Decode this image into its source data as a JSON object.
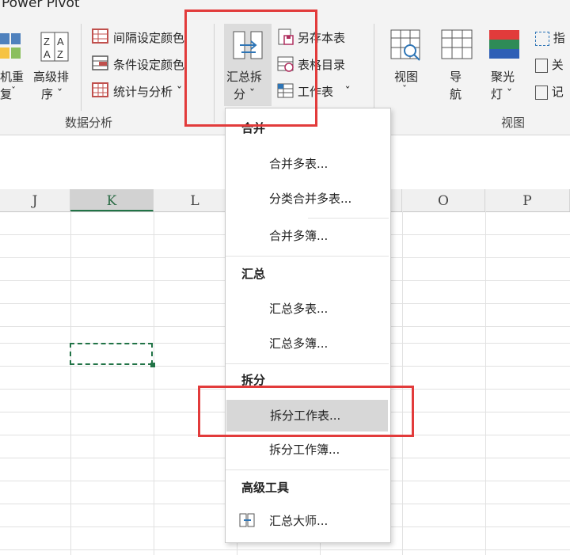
{
  "app_title": "Power Pivot",
  "ribbon": {
    "left_partial_btn": {
      "label_line1": "机重",
      "label_line2": "复"
    },
    "sort_btn": {
      "label_line1": "高级排",
      "label_line2": "序"
    },
    "interval_color": "间隔设定颜色",
    "condition_color": "条件设定颜色",
    "stats_analysis": "统计与分析",
    "group_data_analysis": "数据分析",
    "summary_split": {
      "label_line1": "汇总拆",
      "label_line2": "分"
    },
    "save_as_sheet": "另存本表",
    "sheet_catalog": "表格目录",
    "worksheet": "工作表",
    "view_btn": "视图",
    "nav_btn": {
      "line1": "导",
      "line2": "航"
    },
    "spotlight_btn": {
      "line1": "聚光",
      "line2": "灯"
    },
    "group_view": "视图",
    "right_partial_1": "指",
    "right_partial_2": "关",
    "right_partial_3": "记"
  },
  "columns": [
    "J",
    "K",
    "L",
    "O",
    "P"
  ],
  "selected_column": "K",
  "menu": {
    "sec_merge": "合并",
    "merge_multi_sheets": "合并多表...",
    "classify_merge": "分类合并多表...",
    "merge_multi_books": "合并多簿...",
    "sec_summary": "汇总",
    "summary_multi_sheets": "汇总多表...",
    "summary_multi_books": "汇总多簿...",
    "sec_split": "拆分",
    "split_worksheet": "拆分工作表...",
    "split_workbook": "拆分工作簿...",
    "sec_advanced": "高级工具",
    "summary_master": "汇总大师..."
  },
  "colors": {
    "excel_green": "#217346",
    "annotation_red": "#e23b3b"
  }
}
